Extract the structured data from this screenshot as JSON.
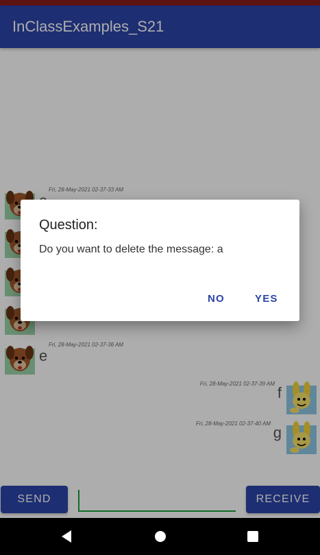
{
  "app": {
    "title": "InClassExamples_S21",
    "colors": {
      "primary": "#2c44a8",
      "status_bar": "#8b1d1d",
      "accent": "#1a9e3a"
    }
  },
  "messages": [
    {
      "side": "left",
      "avatar": "dog-avatar-icon",
      "text": "a",
      "time": "Fri, 28-May-2021 02-37-33 AM"
    },
    {
      "side": "left",
      "avatar": "dog-avatar-icon",
      "text": "",
      "time": ""
    },
    {
      "side": "left",
      "avatar": "dog-avatar-icon",
      "text": "",
      "time": ""
    },
    {
      "side": "left",
      "avatar": "dog-avatar-icon",
      "text": "",
      "time": ""
    },
    {
      "side": "left",
      "avatar": "dog-avatar-icon",
      "text": "e",
      "time": "Fri, 28-May-2021 02-37-36 AM"
    },
    {
      "side": "right",
      "avatar": "rabbit-avatar-icon",
      "text": "f",
      "time": "Fri, 28-May-2021 02-37-39 AM"
    },
    {
      "side": "right",
      "avatar": "rabbit-avatar-icon",
      "text": "g",
      "time": "Fri, 28-May-2021 02-37-40 AM"
    }
  ],
  "composer": {
    "send_label": "SEND",
    "receive_label": "RECEIVE",
    "input_value": ""
  },
  "dialog": {
    "title": "Question:",
    "message": "Do you want to delete the message: a",
    "no_label": "NO",
    "yes_label": "YES"
  },
  "navbar": {
    "icons": [
      "back-icon",
      "home-icon",
      "recents-icon"
    ]
  }
}
